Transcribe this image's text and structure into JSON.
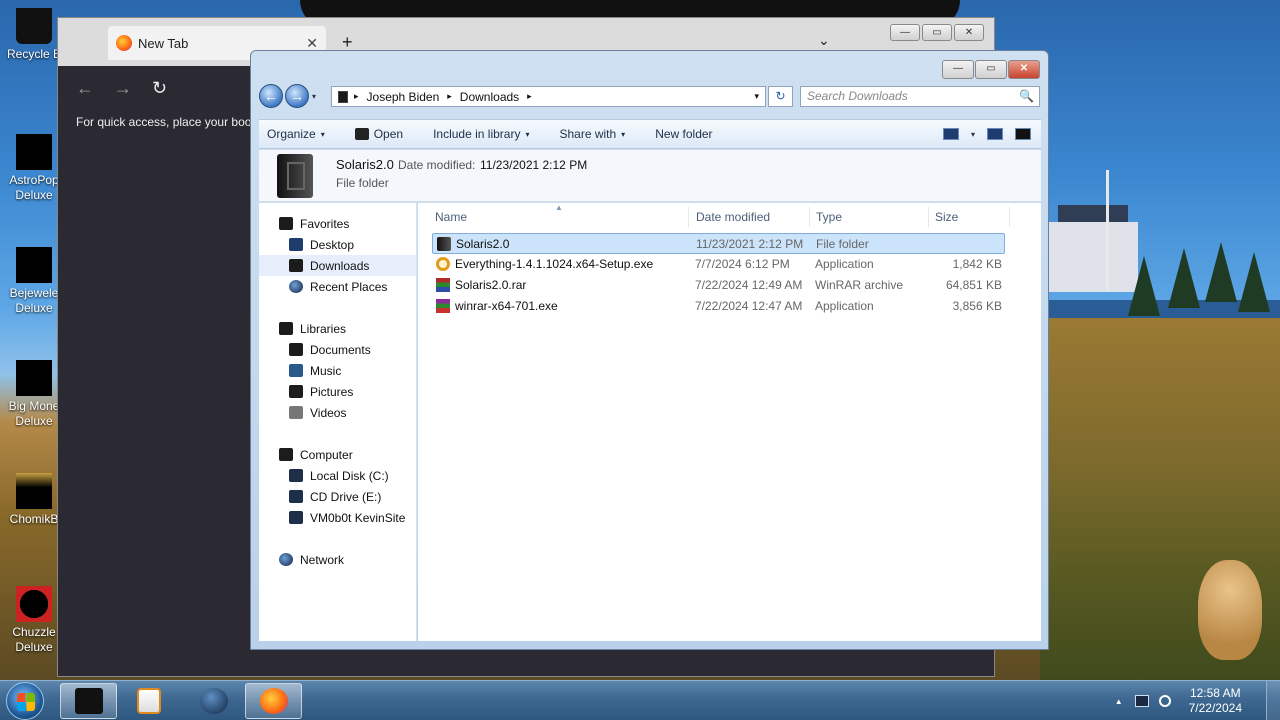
{
  "desktop": {
    "icons": [
      {
        "label": "Recycle B",
        "icon": "recycle-bin-icon"
      },
      {
        "label": "AstroPop Deluxe",
        "icon": "game-icon"
      },
      {
        "label": "Bejewele Deluxe",
        "icon": "game-icon"
      },
      {
        "label": "Big Mone Deluxe",
        "icon": "game-icon"
      },
      {
        "label": "ChomikB",
        "icon": "game-icon"
      },
      {
        "label": "Chuzzle Deluxe",
        "icon": "game-icon"
      }
    ]
  },
  "browser": {
    "tab_title": "New Tab",
    "tab_close": "✕",
    "new_tab": "+",
    "tabs_menu": "⌄",
    "back": "←",
    "forward": "→",
    "reload": "↻",
    "bookmarks_hint": "For quick access, place your book",
    "minimize": "—",
    "maximize": "▭",
    "close": "✕"
  },
  "explorer": {
    "controls": {
      "minimize": "—",
      "maximize": "▭",
      "close": "✕"
    },
    "nav": {
      "back": "←",
      "forward": "→",
      "recent": "▾"
    },
    "address": {
      "crumbs": [
        "Joseph Biden",
        "Downloads"
      ],
      "sep": "▸",
      "drop": "▾"
    },
    "refresh": "↻",
    "search_placeholder": "Search Downloads",
    "search_icon": "🔍",
    "commands": {
      "organize": "Organize",
      "open": "Open",
      "include": "Include in library",
      "share": "Share with",
      "new_folder": "New folder",
      "caret": "▾"
    },
    "details": {
      "name": "Solaris2.0",
      "date_label": "Date modified:",
      "date_value": "11/23/2021 2:12 PM",
      "type": "File folder"
    },
    "navpane": {
      "favorites": "Favorites",
      "desktop": "Desktop",
      "downloads": "Downloads",
      "recent": "Recent Places",
      "libraries": "Libraries",
      "documents": "Documents",
      "music": "Music",
      "pictures": "Pictures",
      "videos": "Videos",
      "computer": "Computer",
      "local_disk": "Local Disk (C:)",
      "cd_drive": "CD Drive (E:)",
      "vm": "VM0b0t KevinSite",
      "network": "Network"
    },
    "columns": {
      "name": "Name",
      "date": "Date modified",
      "type": "Type",
      "size": "Size",
      "sort": "▲"
    },
    "files": [
      {
        "name": "Solaris2.0",
        "date": "11/23/2021 2:12 PM",
        "type": "File folder",
        "size": ""
      },
      {
        "name": "Everything-1.4.1.1024.x64-Setup.exe",
        "date": "7/7/2024 6:12 PM",
        "type": "Application",
        "size": "1,842 KB"
      },
      {
        "name": "Solaris2.0.rar",
        "date": "7/22/2024 12:49 AM",
        "type": "WinRAR archive",
        "size": "64,851 KB"
      },
      {
        "name": "winrar-x64-701.exe",
        "date": "7/22/2024 12:47 AM",
        "type": "Application",
        "size": "3,856 KB"
      }
    ]
  },
  "taskbar": {
    "tray_arrow": "▲",
    "time": "12:58 AM",
    "date": "7/22/2024"
  }
}
